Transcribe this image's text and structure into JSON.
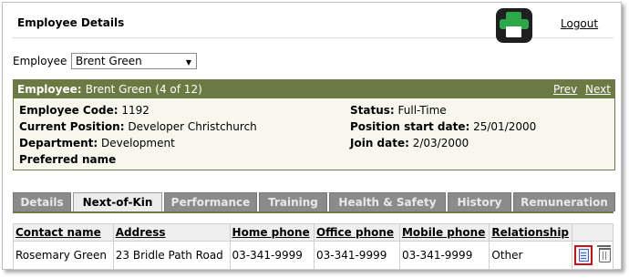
{
  "header": {
    "title": "Employee Details",
    "logout_label": "Logout",
    "print_icon": "printer-icon"
  },
  "employee_select": {
    "label": "Employee",
    "selected": "Brent Green"
  },
  "panel": {
    "heading_label": "Employee:",
    "heading_value": "Brent Green (4 of 12)",
    "prev_label": "Prev",
    "next_label": "Next",
    "fields": {
      "code_label": "Employee Code:",
      "code_value": "1192",
      "position_label": "Current Position:",
      "position_value": "Developer Christchurch",
      "department_label": "Department:",
      "department_value": "Development",
      "preferred_label": "Preferred name",
      "status_label": "Status:",
      "status_value": "Full-Time",
      "pos_start_label": "Position start date:",
      "pos_start_value": "25/01/2000",
      "join_label": "Join date:",
      "join_value": "2/03/2000"
    }
  },
  "tabs": [
    {
      "label": "Details"
    },
    {
      "label": "Next-of-Kin",
      "active": true
    },
    {
      "label": "Performance"
    },
    {
      "label": "Training"
    },
    {
      "label": "Health & Safety"
    },
    {
      "label": "History"
    },
    {
      "label": "Remuneration"
    }
  ],
  "table": {
    "columns": [
      "Contact name",
      "Address",
      "Home phone",
      "Office phone",
      "Mobile phone",
      "Relationship"
    ],
    "rows": [
      [
        "Rosemary Green",
        "23 Bridle Path Road",
        "03-341-9999",
        "03-341-9999",
        "03-341-9999",
        "Other"
      ]
    ],
    "row_actions": [
      "edit-icon",
      "delete-icon"
    ]
  },
  "colors": {
    "panel_header": "#6b7a43",
    "tab_inactive": "#8b8b8b",
    "highlight_border": "#d21010",
    "print_icon_green": "#2ca84a"
  }
}
